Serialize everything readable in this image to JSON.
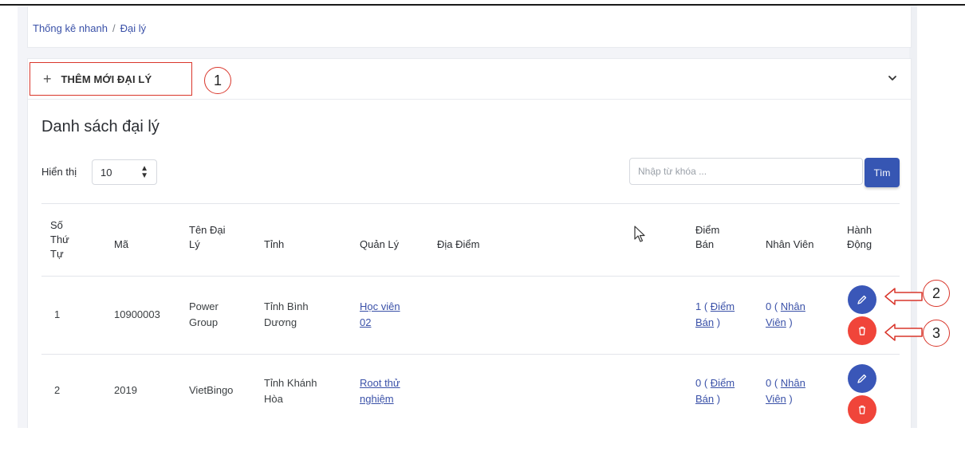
{
  "breadcrumb": {
    "home": "Thống kê nhanh",
    "separator": "/",
    "current": "Đại lý"
  },
  "header": {
    "add_button_label": "THÊM MỚI ĐẠI LÝ",
    "add_icon": "+",
    "collapse_icon": "chevron-down-icon"
  },
  "annotations": {
    "one": "1",
    "two": "2",
    "three": "3"
  },
  "list": {
    "title": "Danh sách đại lý",
    "show_label": "Hiển thị",
    "page_size": "10",
    "search_placeholder": "Nhập từ khóa ...",
    "search_button": "Tìm"
  },
  "table": {
    "columns": {
      "stt_l1": "Số",
      "stt_l2": "Thứ",
      "stt_l3": "Tự",
      "ma": "Mã",
      "ten_l1": "Tên Đại",
      "ten_l2": "Lý",
      "tinh": "Tỉnh",
      "quanly": "Quản Lý",
      "diadiem": "Địa Điểm",
      "diemban_l1": "Điểm",
      "diemban_l2": "Bán",
      "nhanvien": "Nhân Viên",
      "hanhdong_l1": "Hành",
      "hanhdong_l2": "Động"
    },
    "rows": [
      {
        "stt": "1",
        "ma": "10900003",
        "ten_l1": "Power",
        "ten_l2": "Group",
        "tinh_l1": "Tỉnh Bình",
        "tinh_l2": "Dương",
        "quanly_l1": "Học viên",
        "quanly_l2": "02",
        "diemban_count": "1 (",
        "diemban_link_l1": "Điểm",
        "diemban_link_l2": "Bán",
        "diemban_close": ")",
        "nhanvien_count": "0 (",
        "nhanvien_link_l1": "Nhân",
        "nhanvien_link_l2": "Viên",
        "nhanvien_close": ")"
      },
      {
        "stt": "2",
        "ma": "2019",
        "ten_l1": "VietBingo",
        "ten_l2": "",
        "tinh_l1": "Tỉnh Khánh",
        "tinh_l2": "Hòa",
        "quanly_l1": "Root thử",
        "quanly_l2": "nghiệm",
        "diemban_count": "0 (",
        "diemban_link_l1": "Điểm",
        "diemban_link_l2": "Bán",
        "diemban_close": ")",
        "nhanvien_count": "0 (",
        "nhanvien_link_l1": "Nhân",
        "nhanvien_link_l2": "Viên",
        "nhanvien_close": ")"
      }
    ]
  },
  "colors": {
    "primary": "#3656b3",
    "danger": "#f0453a",
    "callout": "#d9362b",
    "link": "#3a51a8"
  }
}
